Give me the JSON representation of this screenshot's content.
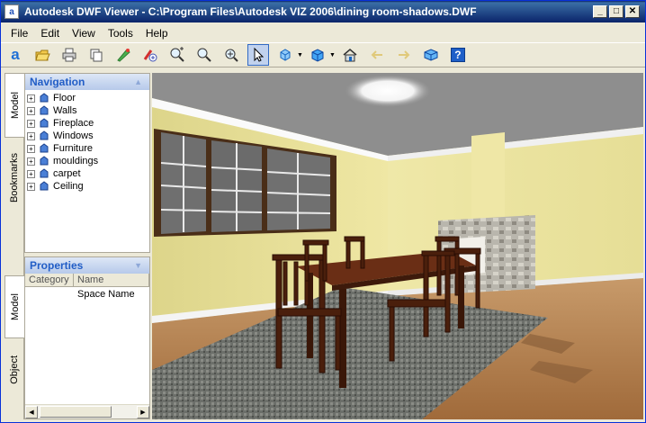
{
  "window": {
    "title": "Autodesk DWF Viewer - C:\\Program Files\\Autodesk VIZ 2006\\dining room-shadows.DWF",
    "app_icon_letter": "a",
    "minimize_glyph": "_",
    "maximize_glyph": "□",
    "close_glyph": "✕"
  },
  "menu": {
    "items": [
      {
        "label": "File"
      },
      {
        "label": "Edit"
      },
      {
        "label": "View"
      },
      {
        "label": "Tools"
      },
      {
        "label": "Help"
      }
    ]
  },
  "toolbar": {
    "logo_letter": "a",
    "tools": [
      "open-icon",
      "print-icon",
      "copy-icon",
      "markup-icon",
      "measure-icon",
      "zoom-in-icon",
      "zoom-icon",
      "fit-icon",
      "select-icon",
      "orbit-icon",
      "cube-icon",
      "home-icon",
      "back-arrow-icon",
      "forward-arrow-icon",
      "3d-view-icon",
      "help-icon"
    ],
    "help_glyph": "?"
  },
  "sidebar": {
    "top_tabs": [
      {
        "label": "Model"
      },
      {
        "label": "Bookmarks"
      }
    ],
    "bottom_tabs": [
      {
        "label": "Model"
      },
      {
        "label": "Object"
      }
    ]
  },
  "navigation": {
    "title": "Navigation",
    "collapse_glyph": "▲",
    "expand_glyph": "+",
    "items": [
      {
        "label": "Floor"
      },
      {
        "label": "Walls"
      },
      {
        "label": "Fireplace"
      },
      {
        "label": "Windows"
      },
      {
        "label": "Furniture"
      },
      {
        "label": "mouldings"
      },
      {
        "label": "carpet"
      },
      {
        "label": "Ceiling"
      }
    ]
  },
  "properties": {
    "title": "Properties",
    "collapse_glyph": "▼",
    "columns": [
      "Category",
      "Name"
    ],
    "rows": [
      {
        "category": "",
        "name": "Space Name"
      }
    ],
    "scroll_left": "◀",
    "scroll_right": "▶"
  },
  "colors": {
    "titlebar": "#0a246a",
    "panel_header_text": "#215dc6",
    "wall": "#e8df92",
    "floor": "#b07a4a",
    "carpet": "#6b6e6a",
    "table": "#5a2a14"
  }
}
